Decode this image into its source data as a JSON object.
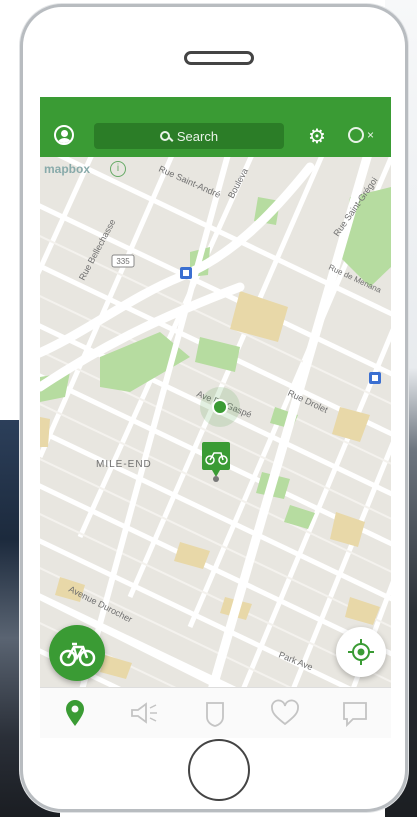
{
  "header": {
    "search_label": "Search"
  },
  "map": {
    "attribution_logo": "mapbox",
    "attribution_info": "i",
    "labels": {
      "rue_saint_andre": "Rue Saint-André",
      "boulevard": "Bouleva",
      "rue_saint_gregoire": "Rue Saint-Grégoi",
      "rue_bellechasse": "Rue Bellechasse",
      "route_335": "335",
      "rue_de_menana": "Rue de Menana",
      "avenue_de_gaspe": "Ave De Gaspé",
      "rue_drolet": "Rue Drolet",
      "mile_end": "MILE-END",
      "avenue_durocher": "Avenue Durocher",
      "park_ave": "Park Ave"
    }
  },
  "icons": {
    "profile": "user-circle-icon",
    "search": "magnifier-icon",
    "settings": "gear-icon",
    "toggle": "toggle-off-icon",
    "metro_station": "metro-icon",
    "user_location": "location-dot-icon",
    "bike_station": "bike-marker-icon",
    "bike_fab": "bicycle-icon",
    "locate_me": "crosshair-icon"
  },
  "tabs": [
    {
      "name": "map",
      "icon": "map-pin-icon"
    },
    {
      "name": "news",
      "icon": "megaphone-icon"
    },
    {
      "name": "badges",
      "icon": "shield-icon"
    },
    {
      "name": "favorites",
      "icon": "heart-icon"
    },
    {
      "name": "messages",
      "icon": "chat-bubble-icon"
    }
  ],
  "colors": {
    "accent": "#3a9b34",
    "accent_dark": "#2b7d27",
    "metro": "#3b6fd1"
  }
}
